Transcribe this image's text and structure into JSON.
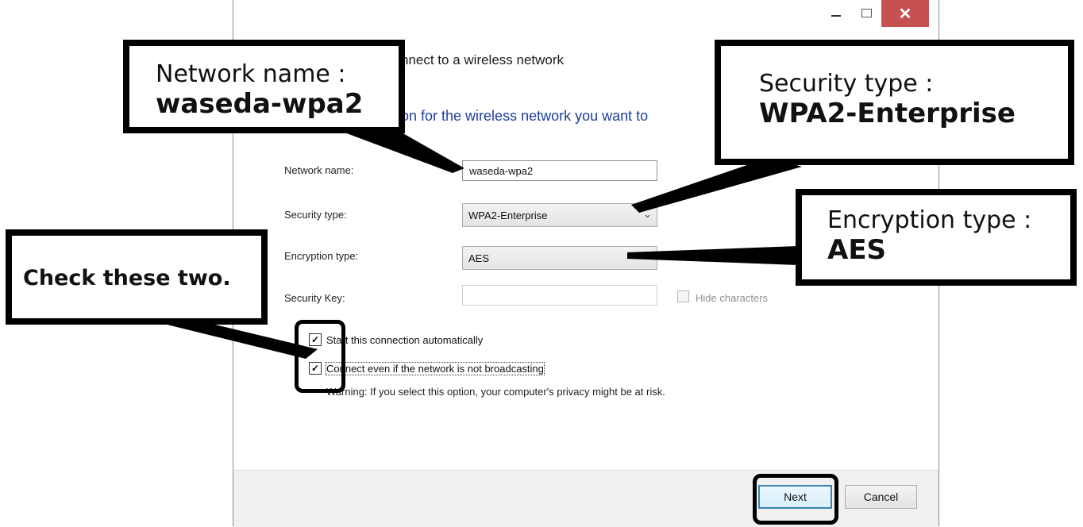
{
  "dialog": {
    "heading": "nnect to a wireless network",
    "subheading": "on for the wireless network you want to",
    "window_controls": {
      "close_glyph": "✕"
    },
    "fields": {
      "network_name": {
        "label": "Network name:",
        "value": "waseda-wpa2"
      },
      "security_type": {
        "label": "Security type:",
        "value": "WPA2-Enterprise"
      },
      "encryption_type": {
        "label": "Encryption type:",
        "value": "AES"
      },
      "security_key": {
        "label": "Security Key:",
        "value": ""
      }
    },
    "hide_characters": {
      "label": "Hide characters",
      "checked": false
    },
    "auto_connect": {
      "label": "Start this connection automatically",
      "checked": true
    },
    "connect_hidden": {
      "label": "Connect even if the network is not broadcasting",
      "checked": true
    },
    "warning": "Warning: If you select this option, your computer's privacy might be at risk.",
    "buttons": {
      "next": "Next",
      "cancel": "Cancel"
    }
  },
  "callouts": {
    "network": {
      "line1": "Network name :",
      "line2": "waseda-wpa2"
    },
    "security": {
      "line1": "Security type :",
      "line2": "WPA2-Enterprise"
    },
    "encryption": {
      "line1": "Encryption type :",
      "line2": "AES"
    },
    "check": {
      "text": "Check these two."
    }
  },
  "colors": {
    "subheading": "#1c3f9b",
    "close_button": "#c75050",
    "primary_button_border": "#3c7fb1",
    "callout_border": "#000000"
  }
}
